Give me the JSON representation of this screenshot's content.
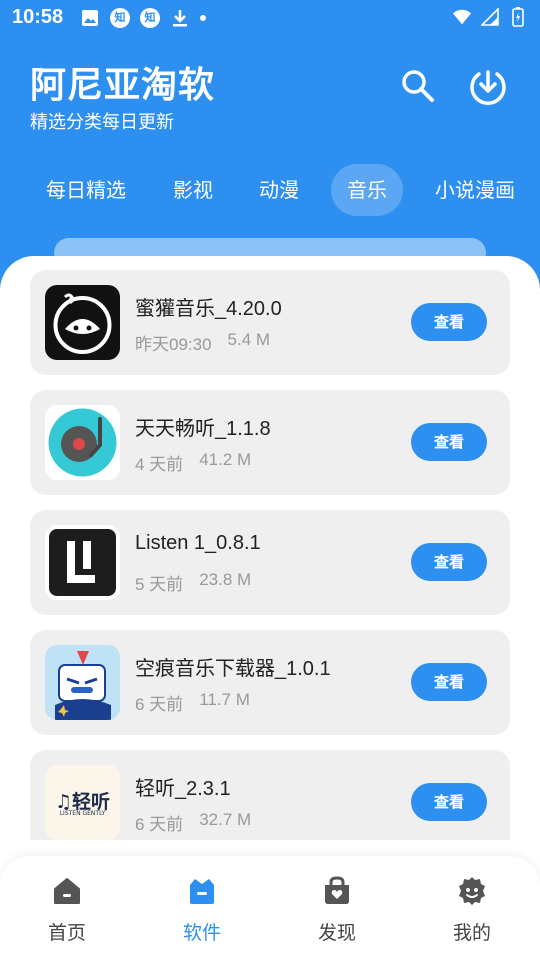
{
  "status_bar": {
    "time": "10:58",
    "notification_icons": [
      "image-icon",
      "zhihu-icon",
      "zhihu-icon",
      "download-icon",
      "dot"
    ],
    "zhihu_glyph": "知"
  },
  "header": {
    "title": "阿尼亚淘软",
    "subtitle": "精选分类每日更新"
  },
  "tabs": [
    {
      "label": "每日精选",
      "active": false
    },
    {
      "label": "影视",
      "active": false
    },
    {
      "label": "动漫",
      "active": false
    },
    {
      "label": "音乐",
      "active": true
    },
    {
      "label": "小说漫画",
      "active": false
    }
  ],
  "apps": [
    {
      "name": "蜜獾音乐_4.20.0",
      "time": "昨天09:30",
      "size": "5.4 M",
      "button": "查看",
      "icon": "honey-badger-music-icon"
    },
    {
      "name": "天天畅听_1.1.8",
      "time": "4 天前",
      "size": "41.2 M",
      "button": "查看",
      "icon": "turntable-icon"
    },
    {
      "name": "Listen 1_0.8.1",
      "time": "5 天前",
      "size": "23.8 M",
      "button": "查看",
      "icon": "listen1-logo-icon"
    },
    {
      "name": "空痕音乐下载器_1.0.1",
      "time": "6 天前",
      "size": "11.7 M",
      "button": "查看",
      "icon": "robot-mascot-icon"
    },
    {
      "name": "轻听_2.3.1",
      "time": "6 天前",
      "size": "32.7 M",
      "button": "查看",
      "icon": "qingting-logo-icon",
      "logo_text": "♫轻听",
      "logo_subtext": "LISTEN GENTLY"
    }
  ],
  "bottom_nav": [
    {
      "label": "首页",
      "icon": "home-icon",
      "active": false
    },
    {
      "label": "软件",
      "icon": "software-icon",
      "active": true
    },
    {
      "label": "发现",
      "icon": "discover-icon",
      "active": false
    },
    {
      "label": "我的",
      "icon": "profile-icon",
      "active": false
    }
  ],
  "colors": {
    "primary": "#2d8ff0",
    "card_bg": "#efefef",
    "meta_text": "#999999"
  }
}
